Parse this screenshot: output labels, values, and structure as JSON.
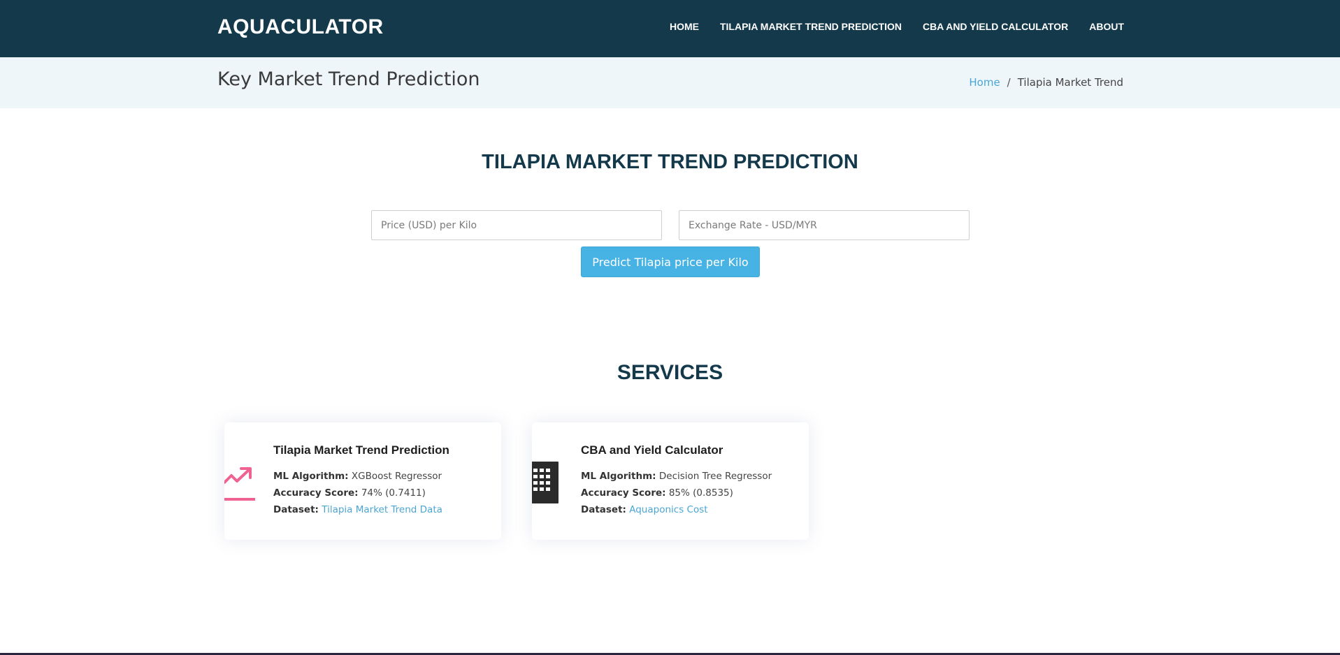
{
  "brand": {
    "logo": "AQUACULATOR"
  },
  "nav": {
    "home": "HOME",
    "tilapia": "TILAPIA MARKET TREND PREDICTION",
    "cba": "CBA AND YIELD CALCULATOR",
    "about": "ABOUT"
  },
  "page": {
    "title": "Key Market Trend Prediction",
    "breadcrumb": {
      "home": "Home",
      "separator": "/",
      "current": "Tilapia Market Trend"
    }
  },
  "prediction": {
    "heading": "TILAPIA MARKET TREND PREDICTION",
    "price_field": {
      "placeholder": "Price (USD) per Kilo",
      "value": ""
    },
    "rate_field": {
      "placeholder": "Exchange Rate - USD/MYR",
      "value": ""
    },
    "button_label": "Predict Tilapia price per Kilo"
  },
  "services": {
    "heading": "SERVICES",
    "cards": [
      {
        "title": "Tilapia Market Trend Prediction",
        "icon": "trending-up-icon",
        "algorithm_label": "ML Algorithm:",
        "algorithm": "XGBoost Regressor",
        "accuracy_label": "Accuracy Score:",
        "accuracy": "74% (0.7411)",
        "dataset_label": "Dataset:",
        "dataset": "Tilapia Market Trend Data"
      },
      {
        "title": "CBA and Yield Calculator",
        "icon": "calculator-icon",
        "algorithm_label": "ML Algorithm:",
        "algorithm": "Decision Tree Regressor",
        "accuracy_label": "Accuracy Score:",
        "accuracy": "85% (0.8535)",
        "dataset_label": "Dataset:",
        "dataset": "Aquaponics Cost"
      }
    ]
  },
  "colors": {
    "header_bg": "#13394b",
    "title_bar_bg": "#eef6fa",
    "accent": "#47b2e4",
    "link": "#4ba5d3",
    "trend_icon": "#f06292"
  }
}
